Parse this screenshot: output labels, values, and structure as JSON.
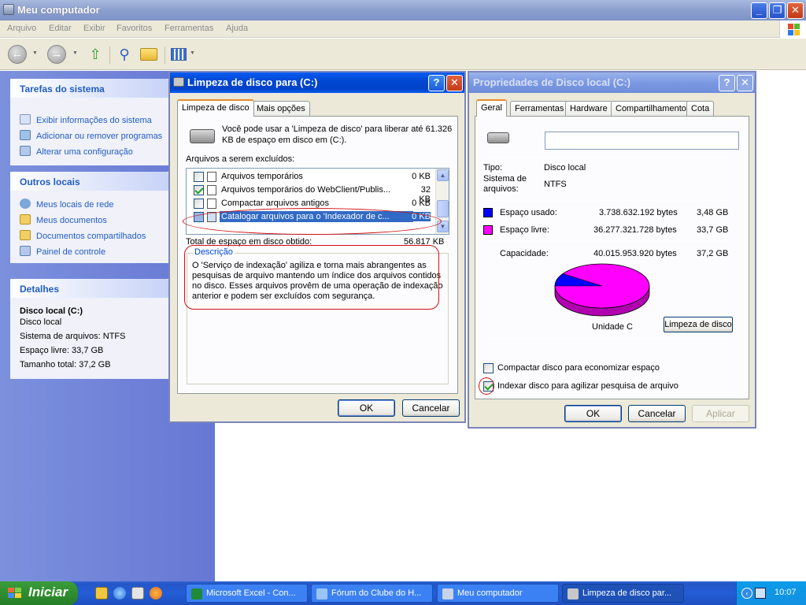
{
  "window": {
    "title": "Meu computador",
    "minimize": "_",
    "maximize": "❐",
    "close": "✕"
  },
  "menu": [
    "Arquivo",
    "Editar",
    "Exibir",
    "Favoritos",
    "Ferramentas",
    "Ajuda"
  ],
  "sidebar": {
    "system_tasks": {
      "title": "Tarefas do sistema",
      "items": [
        "Exibir informações do sistema",
        "Adicionar ou remover programas",
        "Alterar uma configuração"
      ]
    },
    "other_places": {
      "title": "Outros locais",
      "items": [
        "Meus locais de rede",
        "Meus documentos",
        "Documentos compartilhados",
        "Painel de controle"
      ]
    },
    "details": {
      "title": "Detalhes",
      "name": "Disco local (C:)",
      "type": "Disco local",
      "filesystem": "Sistema de arquivos: NTFS",
      "free": "Espaço livre: 33,7 GB",
      "total": "Tamanho total: 37,2 GB"
    }
  },
  "cleanup": {
    "title": "Limpeza de disco para  (C:)",
    "tabs": [
      "Limpeza de disco",
      "Mais opções"
    ],
    "intro_line1": "Você pode usar a 'Limpeza de disco' para liberar até 61.326",
    "intro_line2": "KB de espaço em disco em  (C:).",
    "files_label": "Arquivos a serem excluídos:",
    "files": [
      {
        "name": "Arquivos temporários",
        "size": "0 KB",
        "checked": false
      },
      {
        "name": "Arquivos temporários do WebClient/Publis...",
        "size": "32 KB",
        "checked": true
      },
      {
        "name": "Compactar arquivos antigos",
        "size": "0 KB",
        "checked": false
      },
      {
        "name": "Catalogar arquivos para o 'Indexador de c...",
        "size": "0 KB",
        "checked": false,
        "selected": true
      }
    ],
    "total_label": "Total de espaço em disco obtido:",
    "total_value": "56.817 KB",
    "description_title": "Descrição",
    "description_lines": [
      "O 'Serviço de indexação' agiliza e torna mais abrangentes as",
      "pesquisas de arquivo mantendo um índice dos arquivos contidos",
      "no disco. Esses arquivos provêm de uma operação de indexação",
      "anterior e podem ser excluídos com segurança."
    ],
    "ok": "OK",
    "cancel": "Cancelar"
  },
  "properties": {
    "title": "Propriedades de Disco local (C:)",
    "tabs": [
      "Geral",
      "Ferramentas",
      "Hardware",
      "Compartilhamento",
      "Cota"
    ],
    "label_value": "",
    "type_label": "Tipo:",
    "type_value": "Disco local",
    "fs_label_1": "Sistema de",
    "fs_label_2": "arquivos:",
    "fs_value": "NTFS",
    "used_label": "Espaço usado:",
    "used_bytes": "3.738.632.192 bytes",
    "used_gb": "3,48 GB",
    "free_label": "Espaço livre:",
    "free_bytes": "36.277.321.728 bytes",
    "free_gb": "33,7 GB",
    "capacity_label": "Capacidade:",
    "capacity_bytes": "40.015.953.920 bytes",
    "capacity_gb": "37,2 GB",
    "used_fraction": 0.0934,
    "used_color": "#0000ff",
    "free_color": "#ff00ff",
    "drive_label": "Unidade C",
    "cleanup_button": "Limpeza de disco",
    "compress_label": "Compactar disco para economizar espaço",
    "compress_checked": false,
    "index_label": "Indexar disco para agilizar pesquisa de arquivo",
    "index_checked": true,
    "ok": "OK",
    "cancel": "Cancelar",
    "apply": "Aplicar"
  },
  "taskbar": {
    "start": "Iniciar",
    "tasks": [
      "Microsoft Excel - Con...",
      "Fórum do Clube do H...",
      "Meu computador",
      "Limpeza de disco par..."
    ],
    "clock": "10:07"
  },
  "colors": {
    "selection": "#316ac5",
    "annotation_red": "#d01010",
    "xp_blue": "#0a5cf2"
  }
}
